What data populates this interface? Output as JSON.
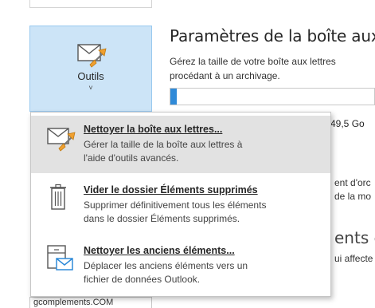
{
  "tools_button": {
    "label": "Outils",
    "chevron": "˅",
    "icon": "mailbox-tools-icon"
  },
  "section": {
    "title": "Paramètres de la boîte aux",
    "description_line1": "Gérez la taille de votre boîte aux lettres",
    "description_line2": "procédant à un archivage.",
    "storage_fraction": 0.02
  },
  "background": {
    "size_text": "49,5 Go",
    "line1": "ent d'orc",
    "line2": "de la mo",
    "title2": "ents e",
    "line3": "ui affecte",
    "footer": "gcomplements.COM"
  },
  "menu": {
    "items": [
      {
        "title": "Nettoyer la boîte aux lettres...",
        "desc_line1": "Gérer la taille de la boîte aux lettres à",
        "desc_line2": "l'aide d'outils avancés.",
        "icon": "mailbox-cleanup-icon"
      },
      {
        "title": "Vider le dossier Éléments supprimés",
        "desc_line1": "Supprimer définitivement tous les éléments",
        "desc_line2": "dans le dossier Éléments supprimés.",
        "icon": "trash-icon"
      },
      {
        "title": "Nettoyer les anciens éléments...",
        "desc_line1": "Déplacer les anciens éléments vers un",
        "desc_line2": "fichier de données Outlook.",
        "icon": "archive-mail-icon"
      }
    ]
  },
  "colors": {
    "accent": "#2f8ad8",
    "button_bg": "#cce4f7",
    "highlight": "#e2e2e2"
  }
}
